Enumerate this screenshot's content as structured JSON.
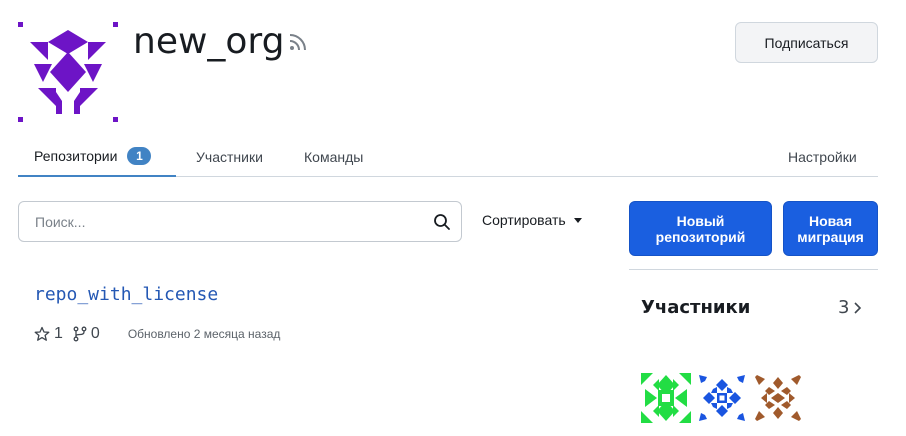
{
  "org": {
    "name": "new_org",
    "avatar_icon": "identicon-purple",
    "follow_label": "Подписаться"
  },
  "tabs": [
    {
      "label": "Репозитории",
      "count": "1",
      "active": true
    },
    {
      "label": "Участники"
    },
    {
      "label": "Команды"
    },
    {
      "label": "Настройки"
    }
  ],
  "toolbar": {
    "search_placeholder": "Поиск...",
    "sort_label": "Сортировать",
    "new_repo_label": "Новый репозиторий",
    "new_migration_label": "Новая миграция"
  },
  "repo": {
    "name": "repo_with_license",
    "stars": "1",
    "forks": "0",
    "updated": "Обновлено 2 месяца назад"
  },
  "members": {
    "title": "Участники",
    "count": "3",
    "avatars": [
      {
        "icon": "identicon-green",
        "color": "#22dd44"
      },
      {
        "icon": "identicon-blue",
        "color": "#1a55e0"
      },
      {
        "icon": "identicon-brown",
        "color": "#a05a2c"
      }
    ]
  },
  "colors": {
    "accent": "#4183c4",
    "primary_button": "#1a5fe0",
    "link": "#2458b4",
    "org_avatar": "#6d14c6"
  }
}
